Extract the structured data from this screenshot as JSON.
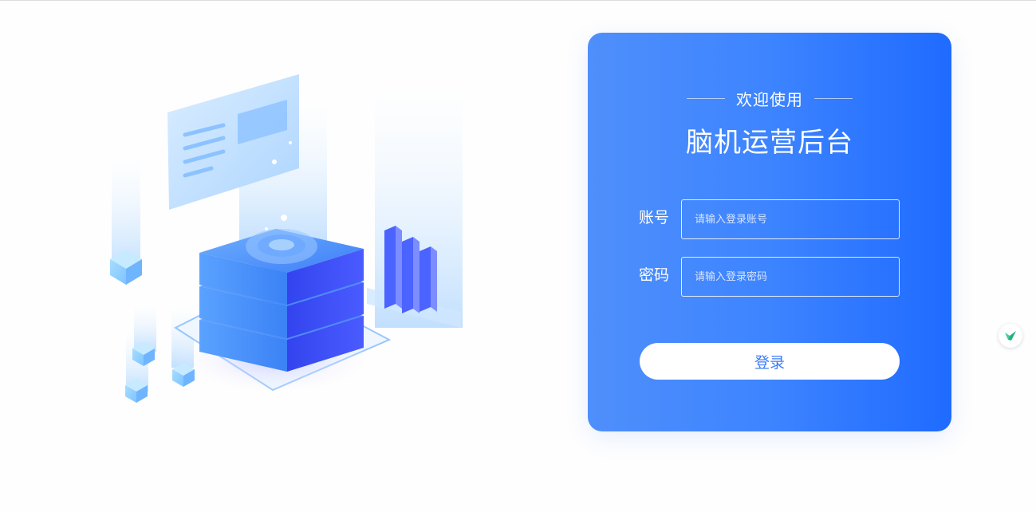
{
  "login": {
    "welcome": "欢迎使用",
    "title": "脑机运营后台",
    "account_label": "账号",
    "account_placeholder": "请输入登录账号",
    "password_label": "密码",
    "password_placeholder": "请输入登录密码",
    "submit_label": "登录"
  },
  "colors": {
    "gradient_start": "#4f8ffb",
    "gradient_end": "#1f6bff",
    "button_text": "#3b7cf5",
    "badge_icon": "#21c48a"
  },
  "icons": {
    "illustration": "server-stack-illustration",
    "floating_badge": "check-badge-icon"
  }
}
